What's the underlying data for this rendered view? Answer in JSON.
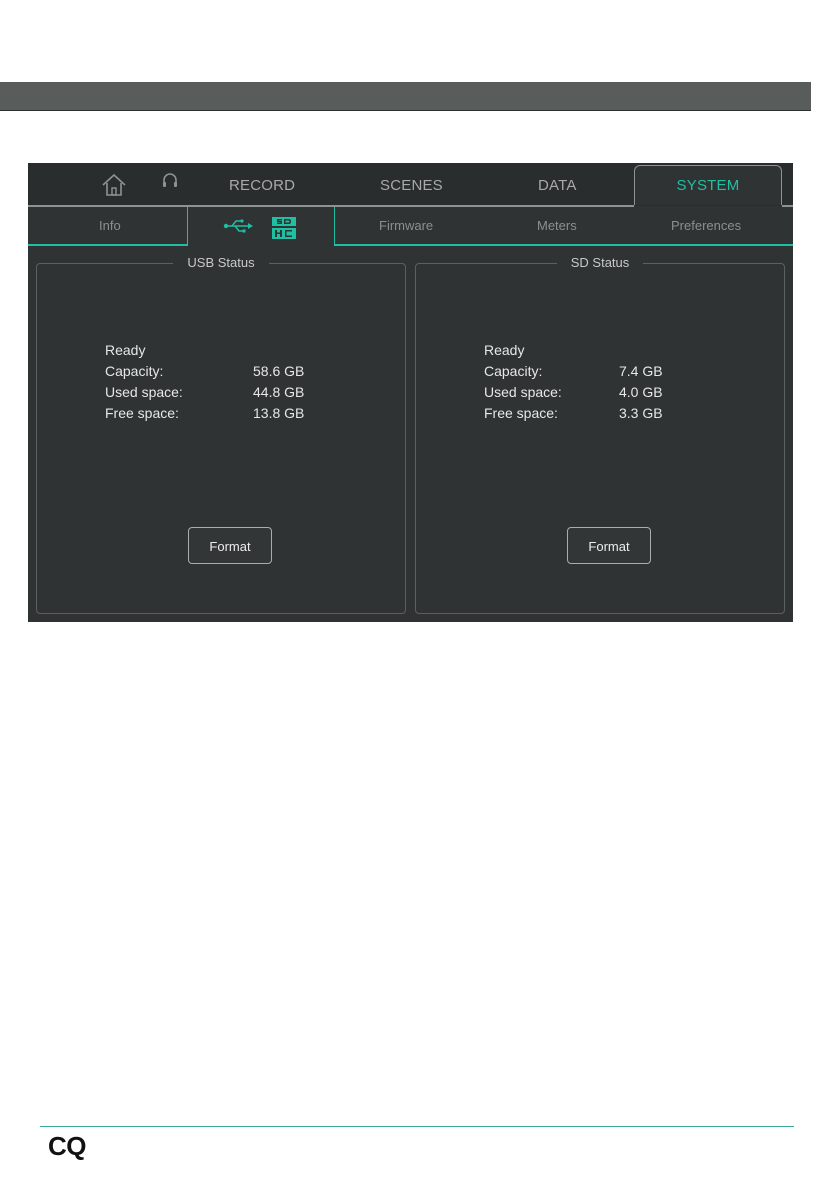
{
  "top_tabs": [
    "RECORD",
    "SCENES",
    "DATA",
    "SYSTEM"
  ],
  "active_top_tab": "SYSTEM",
  "sub_tabs": [
    "Info",
    "Firmware",
    "Meters",
    "Preferences"
  ],
  "usb": {
    "title": "USB Status",
    "status": "Ready",
    "capacity_label": "Capacity:",
    "capacity": "58.6 GB",
    "used_label": "Used space:",
    "used": "44.8 GB",
    "free_label": "Free space:",
    "free": "13.8 GB",
    "format_label": "Format"
  },
  "sd": {
    "title": "SD Status",
    "status": "Ready",
    "capacity_label": "Capacity:",
    "capacity": "7.4 GB",
    "used_label": "Used space:",
    "used": "4.0 GB",
    "free_label": "Free space:",
    "free": "3.3 GB",
    "format_label": "Format"
  },
  "footer": {
    "logo": "CQ"
  },
  "colors": {
    "accent": "#1fbfa4",
    "screen_bg": "#2f3333",
    "header_bar": "#585c5b"
  }
}
